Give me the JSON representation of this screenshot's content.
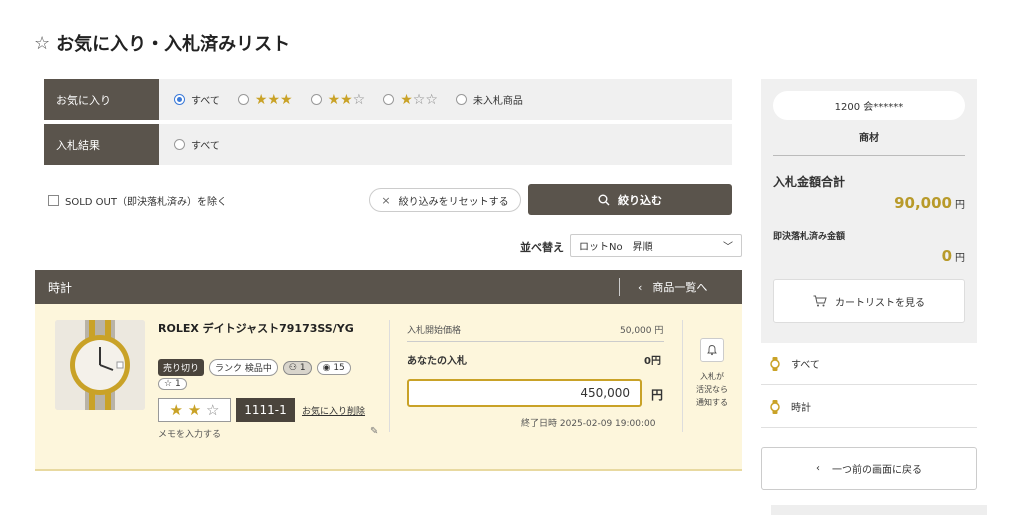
{
  "page": {
    "title": "お気に入り・入札済みリスト"
  },
  "filters": {
    "favorite": {
      "label": "お気に入り",
      "options": [
        {
          "label": "すべて",
          "checked": true
        },
        {
          "stars": 3,
          "max": 3
        },
        {
          "stars": 2,
          "max": 3
        },
        {
          "stars": 1,
          "max": 3
        },
        {
          "label": "未入札商品"
        }
      ]
    },
    "bid_result": {
      "label": "入札結果",
      "options": [
        {
          "label": "すべて"
        }
      ]
    },
    "sold_out": "SOLD OUT（即決落札済み）を除く",
    "reset": "絞り込みをリセットする",
    "search": "絞り込む"
  },
  "sort": {
    "label": "並べ替え",
    "value": "ロットNo　昇順"
  },
  "category": {
    "title": "時計",
    "list_link": "商品一覧へ"
  },
  "item": {
    "title": "ROLEX デイトジャスト79173SS/YG",
    "badge_sell": "売り切り",
    "badge_rank": "ランク 検品中",
    "people_count": "1",
    "view_count": "15",
    "fav_count": "1",
    "rating": 2,
    "rating_max": 3,
    "lot_no": "1111-1",
    "fav_remove": "お気に入り削除",
    "memo": "メモを入力する",
    "start_price_label": "入札開始価格",
    "start_price": "50,000 円",
    "my_bid_label": "あなたの入札",
    "my_bid": "0円",
    "bid_input_value": "450,000",
    "yen": "円",
    "end_time": "終了日時 2025-02-09 19:00:00",
    "notify": "入札が\n活況なら\n通知する"
  },
  "sidebar": {
    "user": "1200 会******",
    "user_sub": "商材",
    "total_label": "入札金額合計",
    "total_value": "90,000",
    "instant_label": "即決落札済み金額",
    "instant_value": "0",
    "unit": "円",
    "cart_button": "カートリストを見る",
    "links": [
      "すべて",
      "時計"
    ],
    "back_button": "一つ前の画面に戻る"
  },
  "colors": {
    "brown": "#5a544c",
    "gold": "#c9a227",
    "card_bg": "#fdf6dc",
    "radio_blue": "#3b7ad8"
  }
}
